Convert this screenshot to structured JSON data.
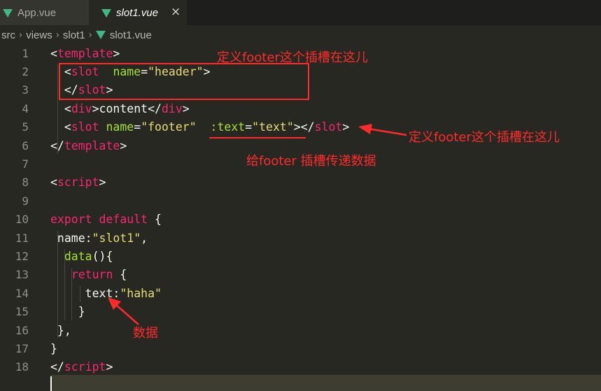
{
  "tabs": [
    {
      "label": "App.vue",
      "active": false
    },
    {
      "label": "slot1.vue",
      "active": true,
      "close": "×"
    }
  ],
  "breadcrumb": [
    "src",
    "views",
    "slot1",
    "slot1.vue"
  ],
  "breadcrumb_sep": "›",
  "code_lines": [
    {
      "n": "1",
      "tokens": [
        [
          "tag_br",
          "<"
        ],
        [
          "tag",
          "template"
        ],
        [
          "pl",
          ">"
        ]
      ]
    },
    {
      "n": "2",
      "tokens": [
        [
          "pl",
          "  <"
        ],
        [
          "tag",
          "slot"
        ],
        [
          "pl",
          "  "
        ],
        [
          "attr",
          "name"
        ],
        [
          "pl",
          "="
        ],
        [
          "str",
          "\"header\""
        ],
        [
          "pl",
          ">"
        ]
      ]
    },
    {
      "n": "3",
      "tokens": [
        [
          "pl",
          "  </"
        ],
        [
          "tag",
          "slot"
        ],
        [
          "pl",
          ">"
        ]
      ]
    },
    {
      "n": "4",
      "tokens": [
        [
          "pl",
          "  <"
        ],
        [
          "tag",
          "div"
        ],
        [
          "pl",
          ">content</"
        ],
        [
          "tag",
          "div"
        ],
        [
          "pl",
          ">"
        ]
      ]
    },
    {
      "n": "5",
      "tokens": [
        [
          "pl",
          "  <"
        ],
        [
          "tag",
          "slot"
        ],
        [
          "pl",
          " "
        ],
        [
          "attr",
          "name"
        ],
        [
          "pl",
          "="
        ],
        [
          "str",
          "\"footer\""
        ],
        [
          "pl",
          "  "
        ],
        [
          "attr",
          ":text"
        ],
        [
          "pl",
          "="
        ],
        [
          "str",
          "\"text\""
        ],
        [
          "pl",
          "></"
        ],
        [
          "tag",
          "slot"
        ],
        [
          "pl",
          ">"
        ]
      ]
    },
    {
      "n": "6",
      "tokens": [
        [
          "pl",
          "</"
        ],
        [
          "tag",
          "template"
        ],
        [
          "pl",
          ">"
        ]
      ]
    },
    {
      "n": "7",
      "tokens": []
    },
    {
      "n": "8",
      "tokens": [
        [
          "pl",
          "<"
        ],
        [
          "tag",
          "script"
        ],
        [
          "pl",
          ">"
        ]
      ]
    },
    {
      "n": "9",
      "tokens": []
    },
    {
      "n": "10",
      "tokens": [
        [
          "kw",
          "export"
        ],
        [
          "pl",
          " "
        ],
        [
          "kw",
          "default"
        ],
        [
          "pl",
          " {"
        ]
      ]
    },
    {
      "n": "11",
      "tokens": [
        [
          "pl",
          " name:"
        ],
        [
          "str",
          "\"slot1\""
        ],
        [
          "pl",
          ","
        ]
      ]
    },
    {
      "n": "12",
      "tokens": [
        [
          "pl",
          "  "
        ],
        [
          "fn",
          "data"
        ],
        [
          "pl",
          "(){"
        ]
      ]
    },
    {
      "n": "13",
      "tokens": [
        [
          "pl",
          "   "
        ],
        [
          "kw",
          "return"
        ],
        [
          "pl",
          " {"
        ]
      ]
    },
    {
      "n": "14",
      "tokens": [
        [
          "pl",
          "     text:"
        ],
        [
          "str",
          "\"haha\""
        ]
      ]
    },
    {
      "n": "15",
      "tokens": [
        [
          "pl",
          "    }"
        ]
      ]
    },
    {
      "n": "16",
      "tokens": [
        [
          "pl",
          " },"
        ]
      ]
    },
    {
      "n": "17",
      "tokens": [
        [
          "pl",
          "}"
        ]
      ]
    },
    {
      "n": "18",
      "tokens": [
        [
          "pl",
          "</"
        ],
        [
          "tag",
          "script"
        ],
        [
          "pl",
          ">"
        ]
      ]
    }
  ],
  "annotations": {
    "define_top": "定义footer这个插槽在这儿",
    "define_right": "定义footer这个插槽在这儿",
    "pass_data": "给footer 插槽传递数据",
    "data": "数据"
  },
  "colors": {
    "background": "#272822",
    "tag": "#f92672",
    "attr": "#a6e22e",
    "string": "#e6db74",
    "annotation": "#ff2b2b",
    "vue_icon": "#41b883"
  }
}
